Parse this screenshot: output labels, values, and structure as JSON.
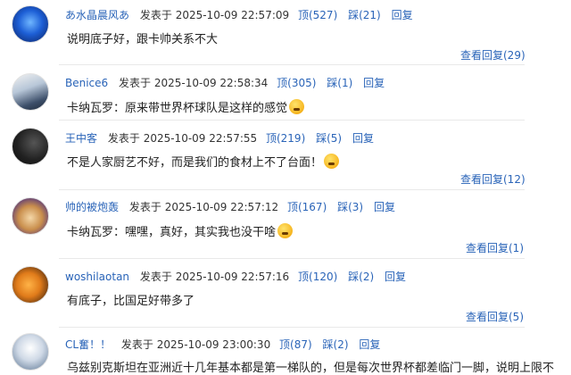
{
  "labels": {
    "posted_at": "发表于",
    "up": "顶",
    "down": "踩",
    "reply": "回复"
  },
  "comments": [
    {
      "user": "あ水晶晨风あ",
      "time": "2025-10-09 22:57:09",
      "up": "(527)",
      "down": "(21)",
      "text": "说明底子好，跟卡帅关系不大",
      "view_replies": "查看回复(29)"
    },
    {
      "user": "Benice6",
      "time": "2025-10-09 22:58:34",
      "up": "(305)",
      "down": "(1)",
      "text": "卡纳瓦罗：原来带世界杯球队是这样的感觉",
      "emoji": "sweat-smile-emoji"
    },
    {
      "user": "王中客",
      "time": "2025-10-09 22:57:55",
      "up": "(219)",
      "down": "(5)",
      "text": "不是人家厨艺不好，而是我们的食材上不了台面！",
      "emoji": "sad-emoji",
      "view_replies": "查看回复(12)"
    },
    {
      "user": "帅的被炮轰",
      "time": "2025-10-09 22:57:12",
      "up": "(167)",
      "down": "(3)",
      "text": "卡纳瓦罗：嘿嘿，真好，其实我也没干啥",
      "emoji": "sweat-emoji",
      "view_replies": "查看回复(1)"
    },
    {
      "user": "woshilaotan",
      "time": "2025-10-09 22:57:16",
      "up": "(120)",
      "down": "(2)",
      "text": "有底子，比国足好带多了",
      "view_replies": "查看回复(5)"
    },
    {
      "user": "CL奮！！",
      "time": "2025-10-09 23:00:30",
      "up": "(87)",
      "down": "(2)",
      "text": "乌兹别克斯坦在亚洲近十几年基本都是第一梯队的，但是每次世界杯都差临门一脚，说明上限不"
    }
  ]
}
